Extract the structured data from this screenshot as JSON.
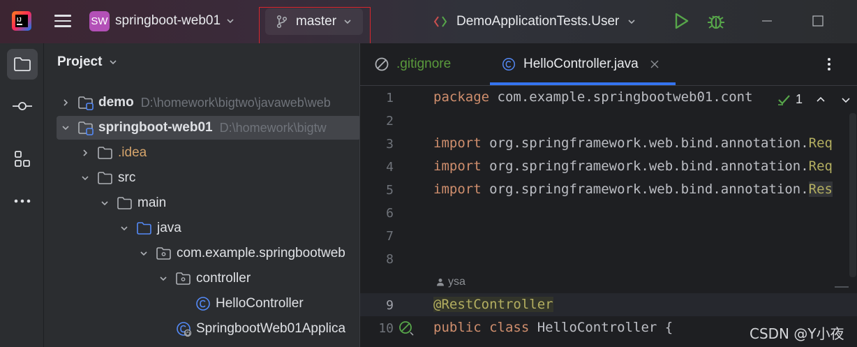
{
  "titlebar": {
    "app_logo": "intellij-idea-logo",
    "project_badge": "SW",
    "project_name": "springboot-web01",
    "vcs_branch": "master",
    "run_config": "DemoApplicationTests.User",
    "icons": {
      "menu": "hamburger-icon",
      "branch": "git-branch-icon",
      "run": "play-icon",
      "debug": "bug-icon",
      "minimize": "minimize-icon",
      "maximize": "maximize-icon"
    },
    "colors": {
      "badge": "#b350b7",
      "run": "#57a64a",
      "debug": "#57a64a",
      "highlight_box": "#d9272d"
    }
  },
  "toolstrip": {
    "items": [
      "project-icon",
      "commit-icon",
      "structure-icon",
      "more-icon"
    ]
  },
  "project_panel": {
    "title": "Project",
    "tree": [
      {
        "label": "demo",
        "path": "D:\\homework\\bigtwo\\javaweb\\web",
        "expanded": false,
        "icon": "module-icon",
        "bold": true
      },
      {
        "label": "springboot-web01",
        "path": "D:\\homework\\bigtw",
        "expanded": true,
        "icon": "module-icon",
        "bold": true,
        "selected": true
      },
      {
        "label": ".idea",
        "expanded": false,
        "icon": "folder-icon"
      },
      {
        "label": "src",
        "expanded": true,
        "icon": "folder-icon"
      },
      {
        "label": "main",
        "expanded": true,
        "icon": "folder-icon"
      },
      {
        "label": "java",
        "expanded": true,
        "icon": "source-folder-icon"
      },
      {
        "label": "com.example.springbootweb",
        "expanded": true,
        "icon": "package-icon"
      },
      {
        "label": "controller",
        "expanded": true,
        "icon": "package-icon"
      },
      {
        "label": "HelloController",
        "icon": "class-icon"
      },
      {
        "label": "SpringbootWeb01Applica",
        "icon": "springboot-class-icon"
      }
    ]
  },
  "editor": {
    "tabs": [
      {
        "label": ".gitignore",
        "icon": "ignored-file-icon",
        "active": false
      },
      {
        "label": "HelloController.java",
        "icon": "class-icon",
        "active": true,
        "closable": true
      }
    ],
    "inspection": {
      "count": "1",
      "icon": "check-icon"
    },
    "author_hint": "ysa",
    "lines": [
      {
        "num": "1",
        "text": "package com.example.springbootweb01.cont"
      },
      {
        "num": "2",
        "text": ""
      },
      {
        "num": "3",
        "text": "import org.springframework.web.bind.annotation.Req"
      },
      {
        "num": "4",
        "text": "import org.springframework.web.bind.annotation.Req"
      },
      {
        "num": "5",
        "text": "import org.springframework.web.bind.annotation.Res"
      },
      {
        "num": "6",
        "text": ""
      },
      {
        "num": "7",
        "text": ""
      },
      {
        "num": "8",
        "text": ""
      },
      {
        "num": "9",
        "text": "@RestController"
      },
      {
        "num": "10",
        "text": "public class HelloController {"
      }
    ],
    "code_tokens": {
      "line1_kw": "package",
      "line1_rest": " com.example.springbootweb01.cont",
      "import_kw": "import",
      "line3_rest": " org.springframework.web.bind.annotation.",
      "line3_tail": "Req",
      "line4_tail": "Req",
      "line5_tail": "Res",
      "line9": "@RestController",
      "line10_kw1": "public",
      "line10_kw2": "class",
      "line10_rest": " HelloController {"
    }
  },
  "watermark": "CSDN @Y小夜"
}
